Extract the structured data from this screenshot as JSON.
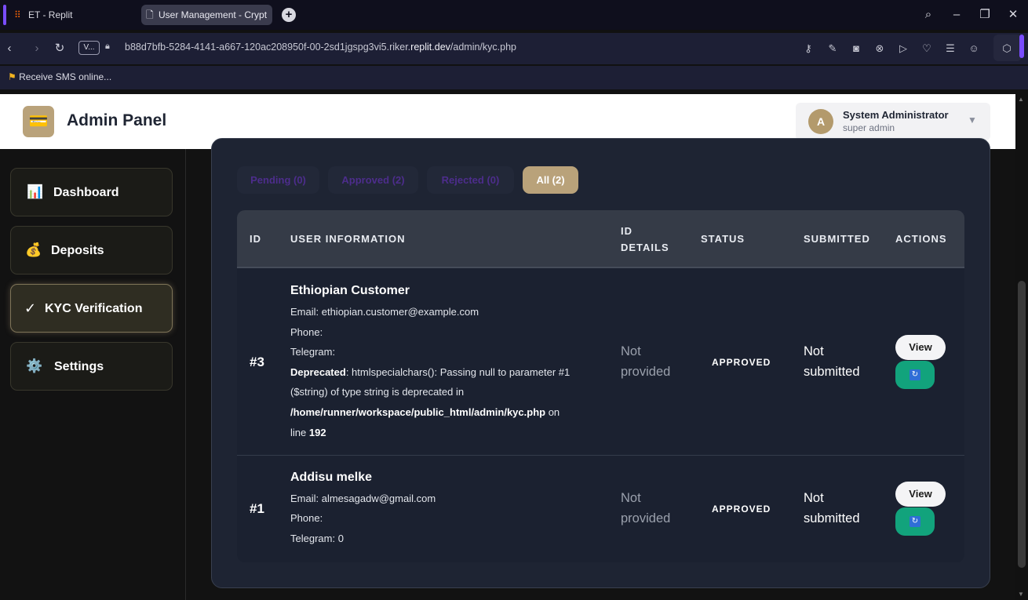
{
  "browser": {
    "tabs": [
      {
        "title": "ET - Replit",
        "active": false
      },
      {
        "title": "User Management - Crypt",
        "active": true
      }
    ],
    "url_prefix": "b88d7bfb-5284-4141-a667-120ac208950f-00-2sd1jgspg3vi5.riker.",
    "url_domain": "replit.dev",
    "url_path": "/admin/kyc.php",
    "site_badge": "V...",
    "bookmark": "Receive SMS online..."
  },
  "header": {
    "brand": "Admin Panel",
    "logo_icon": "credit-card-icon",
    "user_name": "System Administrator",
    "user_role": "super admin",
    "avatar_letter": "A"
  },
  "sidebar": {
    "items": [
      {
        "label": "Dashboard",
        "icon": "📊"
      },
      {
        "label": "Deposits",
        "icon": "💰"
      },
      {
        "label": "KYC Verification",
        "icon": "✓",
        "active": true
      },
      {
        "label": "Settings",
        "icon": "⚙️"
      }
    ]
  },
  "filters": [
    {
      "label": "Pending (0)"
    },
    {
      "label": "Approved (2)"
    },
    {
      "label": "Rejected (0)"
    },
    {
      "label": "All (2)",
      "active": true
    }
  ],
  "table": {
    "headers": {
      "id": "ID",
      "user_info": "USER INFORMATION",
      "id_details_1": "ID",
      "id_details_2": "DETAILS",
      "status": "STATUS",
      "submitted": "SUBMITTED",
      "actions": "ACTIONS"
    },
    "rows": [
      {
        "id": "#3",
        "name": "Ethiopian Customer",
        "email": "Email: ethiopian.customer@example.com",
        "phone": "Phone:",
        "telegram": "Telegram:",
        "warning_label": "Deprecated",
        "warning_line1": ": htmlspecialchars(): Passing null to parameter #1",
        "warning_line2": "($string) of type string is deprecated in",
        "warning_path": "/home/runner/workspace/public_html/admin/kyc.php",
        "warning_on": " on",
        "warning_line_word": "line ",
        "warning_line_no": "192",
        "id_details_1": "Not",
        "id_details_2": "provided",
        "status": "APPROVED",
        "submitted_1": "Not",
        "submitted_2": "submitted",
        "view_label": "View"
      },
      {
        "id": "#1",
        "name": "Addisu melke",
        "email": "Email: almesagadw@gmail.com",
        "phone": "Phone:",
        "telegram": "Telegram: 0",
        "id_details_1": "Not",
        "id_details_2": "provided",
        "status": "APPROVED",
        "submitted_1": "Not",
        "submitted_2": "submitted",
        "view_label": "View"
      }
    ]
  },
  "colors": {
    "accent": "#b9a27a",
    "approve_button": "#12a37c",
    "card_bg": "#1e2433"
  }
}
